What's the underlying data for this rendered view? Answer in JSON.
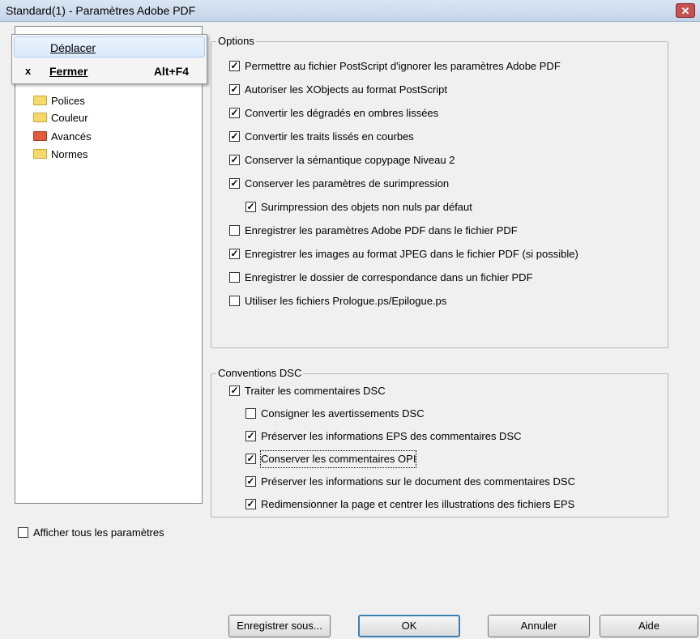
{
  "window": {
    "title": "Standard(1) - Paramètres Adobe PDF",
    "close_glyph": "✕"
  },
  "system_menu": {
    "items": [
      {
        "label": "Déplacer",
        "mnemonic_index": 0,
        "prefix": "",
        "shortcut": ""
      },
      {
        "label": "Fermer",
        "mnemonic_index": 0,
        "prefix": "x",
        "shortcut": "Alt+F4"
      }
    ]
  },
  "tree": {
    "items": [
      {
        "label": "Polices",
        "icon": "folder-icon"
      },
      {
        "label": "Couleur",
        "icon": "folder-icon"
      },
      {
        "label": "Avancés",
        "icon": "folder-open-icon"
      },
      {
        "label": "Normes",
        "icon": "folder-icon"
      }
    ]
  },
  "options": {
    "title": "Options",
    "items": [
      {
        "text": "Permettre au fichier PostScript d'ignorer les paramètres Adobe PDF",
        "checked": true
      },
      {
        "text": "Autoriser les XObjects au format PostScript",
        "checked": true
      },
      {
        "text": "Convertir les dégradés en ombres lissées",
        "checked": true
      },
      {
        "text": "Convertir les traits lissés en courbes",
        "checked": true
      },
      {
        "text": "Conserver la sémantique copypage Niveau 2",
        "checked": true
      },
      {
        "text": "Conserver les paramètres de surimpression",
        "checked": true
      },
      {
        "text": "Surimpression des objets non nuls par défaut",
        "checked": true
      },
      {
        "text": "Enregistrer les paramètres Adobe PDF dans le fichier PDF",
        "checked": false
      },
      {
        "text": "Enregistrer les images au format JPEG dans le fichier PDF (si possible)",
        "checked": true
      },
      {
        "text": "Enregistrer le dossier de correspondance dans un fichier PDF",
        "checked": false
      },
      {
        "text": "Utiliser les fichiers Prologue.ps/Epilogue.ps",
        "checked": false
      }
    ]
  },
  "dsc": {
    "title": "Conventions DSC",
    "items": [
      {
        "text": "Traiter les commentaires DSC",
        "checked": true
      },
      {
        "text": "Consigner les avertissements DSC",
        "checked": false
      },
      {
        "text": "Préserver les informations EPS des commentaires DSC",
        "checked": true
      },
      {
        "text": "Conserver les commentaires OPI",
        "checked": true
      },
      {
        "text": "Préserver les informations sur le document des commentaires DSC",
        "checked": true
      },
      {
        "text": "Redimensionner la page et centrer les illustrations des fichiers EPS",
        "checked": true
      }
    ]
  },
  "show_all": {
    "text": "Afficher tous les paramètres",
    "checked": false
  },
  "buttons": {
    "save_as": "Enregistrer sous...",
    "ok": "OK",
    "cancel": "Annuler",
    "help": "Aide"
  },
  "check_glyph": "✓"
}
